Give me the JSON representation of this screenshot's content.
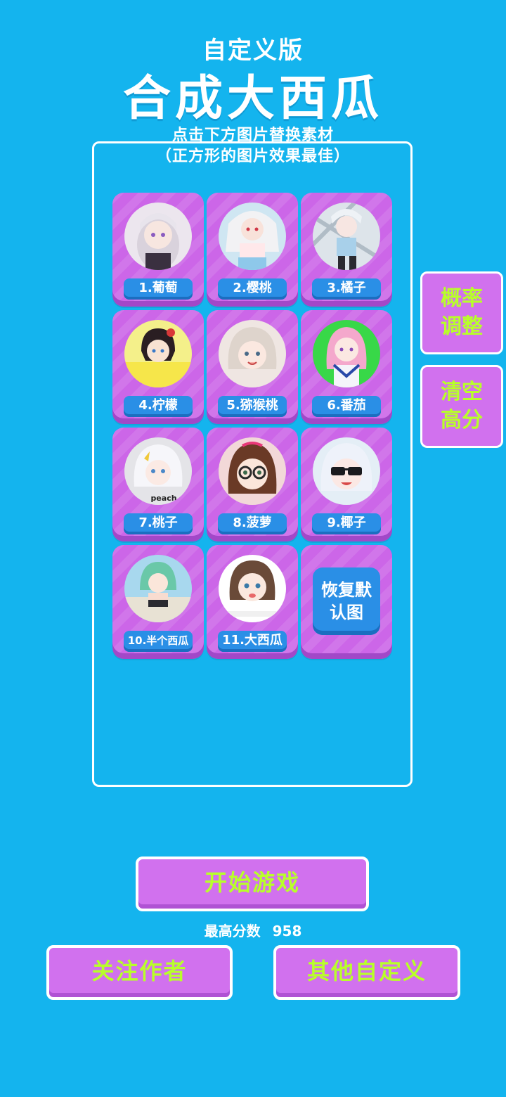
{
  "header": {
    "subtitle": "自定义版",
    "title": "合成大西瓜",
    "hint_line1": "点击下方图片替换素材",
    "hint_line2": "（正方形的图片效果最佳）"
  },
  "fruits": [
    {
      "label": "1.葡萄"
    },
    {
      "label": "2.樱桃"
    },
    {
      "label": "3.橘子"
    },
    {
      "label": "4.柠檬"
    },
    {
      "label": "5.猕猴桃"
    },
    {
      "label": "6.番茄"
    },
    {
      "label": "7.桃子",
      "image_text": "peach"
    },
    {
      "label": "8.菠萝"
    },
    {
      "label": "9.椰子"
    },
    {
      "label": "10.半个西瓜"
    },
    {
      "label": "11.大西瓜"
    }
  ],
  "restore_button": "恢复默认图",
  "side_buttons": {
    "probability": "概率调整",
    "clear_score": "清空高分"
  },
  "start_button": "开始游戏",
  "high_score": {
    "label": "最高分数",
    "value": "958"
  },
  "bottom_buttons": {
    "follow": "关注作者",
    "other_custom": "其他自定义"
  },
  "colors": {
    "background": "#14b4ee",
    "tile": "#cc66e8",
    "pill": "#2a8fe6",
    "button_text": "#b8ff2a"
  }
}
